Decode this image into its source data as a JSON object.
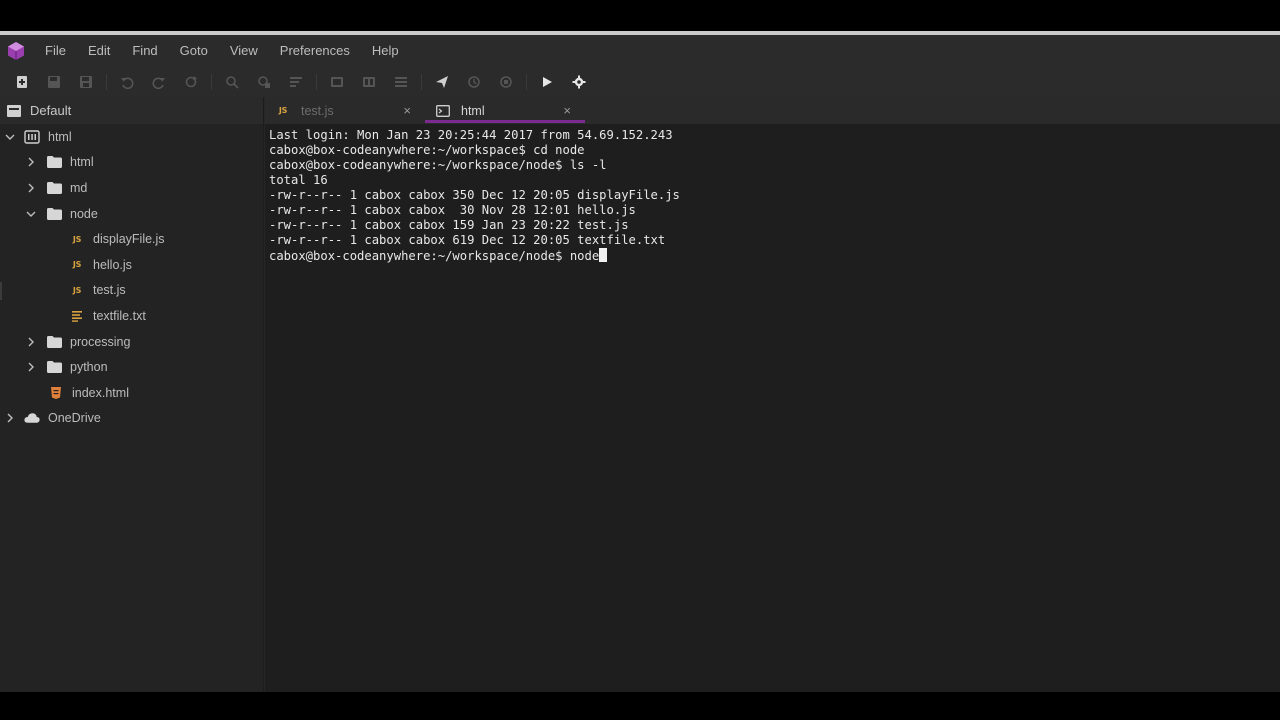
{
  "menu": [
    "File",
    "Edit",
    "Find",
    "Goto",
    "View",
    "Preferences",
    "Help"
  ],
  "sidebar": {
    "header": "Default",
    "tree": [
      {
        "label": "html",
        "type": "project",
        "level": 0,
        "expanded": true
      },
      {
        "label": "html",
        "type": "folder",
        "level": 1,
        "expanded": false
      },
      {
        "label": "md",
        "type": "folder",
        "level": 1,
        "expanded": false
      },
      {
        "label": "node",
        "type": "folder",
        "level": 1,
        "expanded": true
      },
      {
        "label": "displayFile.js",
        "type": "js",
        "level": 2
      },
      {
        "label": "hello.js",
        "type": "js",
        "level": 2
      },
      {
        "label": "test.js",
        "type": "js",
        "level": 2
      },
      {
        "label": "textfile.txt",
        "type": "txt",
        "level": 2
      },
      {
        "label": "processing",
        "type": "folder",
        "level": 1,
        "expanded": false
      },
      {
        "label": "python",
        "type": "folder",
        "level": 1,
        "expanded": false
      },
      {
        "label": "index.html",
        "type": "html",
        "level": 1
      },
      {
        "label": "OneDrive",
        "type": "cloud",
        "level": 0,
        "expanded": false
      }
    ]
  },
  "tabs": [
    {
      "label": "test.js",
      "icon": "js-icon",
      "active": false,
      "close": "×"
    },
    {
      "label": "html",
      "icon": "terminal-icon",
      "active": true,
      "close": "×"
    }
  ],
  "terminal": {
    "lines": [
      "Last login: Mon Jan 23 20:25:44 2017 from 54.69.152.243",
      "cabox@box-codeanywhere:~/workspace$ cd node",
      "cabox@box-codeanywhere:~/workspace/node$ ls -l",
      "total 16",
      "-rw-r--r-- 1 cabox cabox 350 Dec 12 20:05 displayFile.js",
      "-rw-r--r-- 1 cabox cabox  30 Nov 28 12:01 hello.js",
      "-rw-r--r-- 1 cabox cabox 159 Jan 23 20:22 test.js",
      "-rw-r--r-- 1 cabox cabox 619 Dec 12 20:05 textfile.txt"
    ],
    "prompt_line": "cabox@box-codeanywhere:~/workspace/node$ node"
  },
  "colors": {
    "accent": "#7b2a8f",
    "js_badge": "#d9a441",
    "html_file": "#e0803a",
    "background": "#262626",
    "terminal_bg": "#1e1e1e"
  }
}
